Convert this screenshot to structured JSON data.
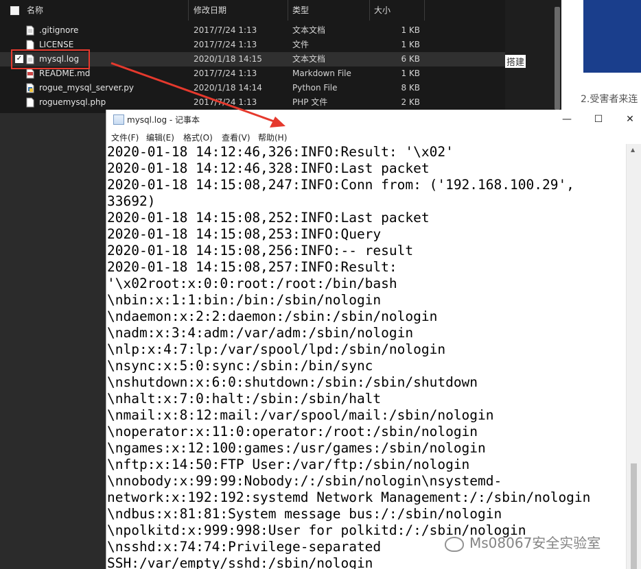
{
  "explorer": {
    "columns": {
      "name": "名称",
      "date": "修改日期",
      "type": "类型",
      "size": "大小"
    },
    "files": [
      {
        "name": ".gitignore",
        "date": "2017/7/24 1:13",
        "type": "文本文档",
        "size": "1 KB",
        "icon": "text-file-icon"
      },
      {
        "name": "LICENSE",
        "date": "2017/7/24 1:13",
        "type": "文件",
        "size": "1 KB",
        "icon": "file-icon"
      },
      {
        "name": "mysql.log",
        "date": "2020/1/18 14:15",
        "type": "文本文档",
        "size": "6 KB",
        "icon": "text-file-icon",
        "selected": true
      },
      {
        "name": "README.md",
        "date": "2017/7/24 1:13",
        "type": "Markdown File",
        "size": "1 KB",
        "icon": "markdown-file-icon"
      },
      {
        "name": "rogue_mysql_server.py",
        "date": "2020/1/18 14:14",
        "type": "Python File",
        "size": "8 KB",
        "icon": "python-file-icon"
      },
      {
        "name": "roguemysql.php",
        "date": "2017/7/24 1:13",
        "type": "PHP 文件",
        "size": "2 KB",
        "icon": "php-file-icon"
      }
    ]
  },
  "background": {
    "text1": "搭建",
    "text2": "2.受害者来连"
  },
  "notepad": {
    "title": "mysql.log - 记事本",
    "window_buttons": {
      "minimize": "—",
      "maximize": "☐",
      "close": "✕"
    },
    "menu": [
      "文件(F)",
      "编辑(E)",
      "格式(O)",
      "查看(V)",
      "帮助(H)"
    ],
    "lines": [
      "2020-01-18 14:12:46,326:INFO:Result: '\\x02'",
      "2020-01-18 14:12:46,328:INFO:Last packet",
      "2020-01-18 14:15:08,247:INFO:Conn from: ('192.168.100.29',",
      "33692)",
      "2020-01-18 14:15:08,252:INFO:Last packet",
      "2020-01-18 14:15:08,253:INFO:Query",
      "2020-01-18 14:15:08,256:INFO:-- result",
      "2020-01-18 14:15:08,257:INFO:Result:",
      "'\\x02root:x:0:0:root:/root:/bin/bash",
      "\\nbin:x:1:1:bin:/bin:/sbin/nologin",
      "\\ndaemon:x:2:2:daemon:/sbin:/sbin/nologin",
      "\\nadm:x:3:4:adm:/var/adm:/sbin/nologin",
      "\\nlp:x:4:7:lp:/var/spool/lpd:/sbin/nologin",
      "\\nsync:x:5:0:sync:/sbin:/bin/sync",
      "\\nshutdown:x:6:0:shutdown:/sbin:/sbin/shutdown",
      "\\nhalt:x:7:0:halt:/sbin:/sbin/halt",
      "\\nmail:x:8:12:mail:/var/spool/mail:/sbin/nologin",
      "\\noperator:x:11:0:operator:/root:/sbin/nologin",
      "\\ngames:x:12:100:games:/usr/games:/sbin/nologin",
      "\\nftp:x:14:50:FTP User:/var/ftp:/sbin/nologin",
      "\\nnobody:x:99:99:Nobody:/:/sbin/nologin\\nsystemd-",
      "network:x:192:192:systemd Network Management:/:/sbin/nologin",
      "\\ndbus:x:81:81:System message bus:/:/sbin/nologin",
      "\\npolkitd:x:999:998:User for polkitd:/:/sbin/nologin",
      "\\nsshd:x:74:74:Privilege-separated",
      "SSH:/var/empty/sshd:/sbin/nologin"
    ]
  },
  "watermark": "Ms08067安全实验室",
  "colors": {
    "highlight": "#e5392d",
    "explorer_bg": "#191919"
  }
}
